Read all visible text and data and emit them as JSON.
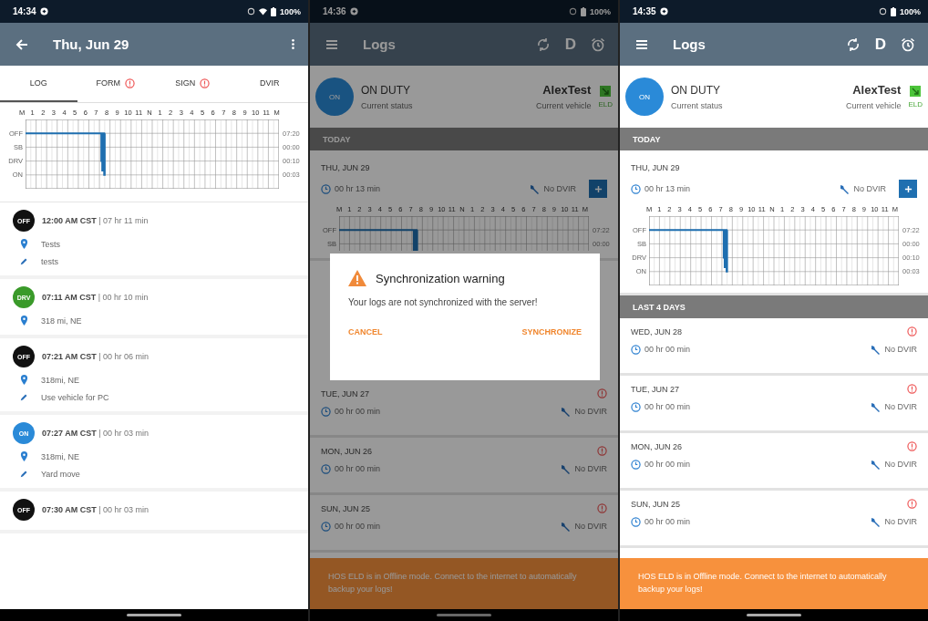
{
  "screens": [
    {
      "kind": "day_log",
      "status_bar": {
        "time": "14:34",
        "wifi": true,
        "battery": "100%"
      },
      "app_bar": {
        "title": "Thu, Jun 29",
        "actions": [
          {
            "kind": "more"
          }
        ]
      },
      "tabs": [
        {
          "label": "LOG",
          "selected": true,
          "alert": false
        },
        {
          "label": "FORM",
          "selected": false,
          "alert": true
        },
        {
          "label": "SIGN",
          "selected": false,
          "alert": true
        },
        {
          "label": "DVIR",
          "selected": false,
          "alert": false
        }
      ],
      "graph": {
        "hours": [
          "M",
          "1",
          "2",
          "3",
          "4",
          "5",
          "6",
          "7",
          "8",
          "9",
          "10",
          "11",
          "N",
          "1",
          "2",
          "3",
          "4",
          "5",
          "6",
          "7",
          "8",
          "9",
          "10",
          "11",
          "M"
        ],
        "rows": [
          "OFF",
          "SB",
          "DRV",
          "ON"
        ],
        "totals": [
          "07:20",
          "00:00",
          "00:10",
          "00:03"
        ]
      },
      "events": [
        {
          "status": "OFF",
          "color": "#111111",
          "heading": "**12:00 AM CST** | 07 hr 11 min",
          "details": [
            {
              "kind": "location",
              "text": "Tests"
            },
            {
              "kind": "note",
              "text": "tests"
            }
          ]
        },
        {
          "status": "DRV",
          "color": "#3a9a2a",
          "heading": "**07:11 AM CST** | 00 hr 10 min",
          "details": [
            {
              "kind": "location",
              "text": "318 mi, NE"
            }
          ]
        },
        {
          "status": "OFF",
          "color": "#111111",
          "heading": "**07:21 AM CST** | 00 hr 06 min",
          "details": [
            {
              "kind": "location",
              "text": "318mi, NE"
            },
            {
              "kind": "note",
              "text": "Use vehicle for PC"
            }
          ]
        },
        {
          "status": "ON",
          "color": "#2a8ad8",
          "heading": "**07:27 AM CST** | 00 hr 03 min",
          "details": [
            {
              "kind": "location",
              "text": "318mi, NE"
            },
            {
              "kind": "note",
              "text": "Yard move"
            }
          ]
        },
        {
          "status": "OFF",
          "color": "#111111",
          "heading": "**07:30 AM CST** | 00 hr 03 min"
        }
      ]
    },
    {
      "kind": "logs",
      "status_bar": {
        "time": "14:36",
        "wifi": false,
        "battery": "100%"
      },
      "app_bar": {
        "title": "Logs",
        "actions": [
          {
            "kind": "sync"
          },
          {
            "kind": "text",
            "text": "D"
          },
          {
            "kind": "alarm"
          }
        ]
      },
      "duty": {
        "status": "ON",
        "label": "ON DUTY",
        "sub": "Current status",
        "vehicle": "AlexTest",
        "vehicle_sub": "Current vehicle",
        "eld": "ELD"
      },
      "today_header": "TODAY",
      "today": {
        "date": "THU, JUN 29",
        "duration": "00 hr 13 min",
        "dvir": "No DVIR"
      },
      "graph": {
        "hours": [
          "M",
          "1",
          "2",
          "3",
          "4",
          "5",
          "6",
          "7",
          "8",
          "9",
          "10",
          "11",
          "N",
          "1",
          "2",
          "3",
          "4",
          "5",
          "6",
          "7",
          "8",
          "9",
          "10",
          "11",
          "M"
        ],
        "rows": [
          "OFF",
          "SB"
        ],
        "totals": [
          "07:22",
          "00:00"
        ]
      },
      "days": [
        {
          "date": "TUE, JUN 27",
          "duration": "00 hr 00 min",
          "dvir": "No DVIR",
          "alert": true
        },
        {
          "date": "MON, JUN 26",
          "duration": "00 hr 00 min",
          "dvir": "No DVIR",
          "alert": true
        },
        {
          "date": "SUN, JUN 25",
          "duration": "00 hr 00 min",
          "dvir": "No DVIR",
          "alert": true
        }
      ],
      "banner": "HOS ELD is in Offline mode. Connect to the internet to automatically backup your logs!",
      "dialog": {
        "title": "Synchronization warning",
        "message": "Your logs are not synchronized with the server!",
        "buttons": [
          "CANCEL",
          "SYNCHRONIZE"
        ]
      }
    },
    {
      "kind": "logs",
      "status_bar": {
        "time": "14:35",
        "wifi": false,
        "battery": "100%"
      },
      "app_bar": {
        "title": "Logs",
        "actions": [
          {
            "kind": "sync"
          },
          {
            "kind": "text",
            "text": "D"
          },
          {
            "kind": "alarm"
          }
        ]
      },
      "duty": {
        "status": "ON",
        "label": "ON DUTY",
        "sub": "Current status",
        "vehicle": "AlexTest",
        "vehicle_sub": "Current vehicle",
        "eld": "ELD"
      },
      "today_header": "TODAY",
      "today": {
        "date": "THU, JUN 29",
        "duration": "00 hr 13 min",
        "dvir": "No DVIR"
      },
      "graph": {
        "hours": [
          "M",
          "1",
          "2",
          "3",
          "4",
          "5",
          "6",
          "7",
          "8",
          "9",
          "10",
          "11",
          "N",
          "1",
          "2",
          "3",
          "4",
          "5",
          "6",
          "7",
          "8",
          "9",
          "10",
          "11",
          "M"
        ],
        "rows": [
          "OFF",
          "SB",
          "DRV",
          "ON"
        ],
        "totals": [
          "07:22",
          "00:00",
          "00:10",
          "00:03"
        ]
      },
      "days_header": "LAST 4 DAYS",
      "days": [
        {
          "date": "WED, JUN 28",
          "duration": "00 hr 00 min",
          "dvir": "No DVIR",
          "alert": true
        },
        {
          "date": "TUE, JUN 27",
          "duration": "00 hr 00 min",
          "dvir": "No DVIR",
          "alert": true
        },
        {
          "date": "MON, JUN 26",
          "duration": "00 hr 00 min",
          "dvir": "No DVIR",
          "alert": true
        },
        {
          "date": "SUN, JUN 25",
          "duration": "00 hr 00 min",
          "dvir": "No DVIR",
          "alert": true
        }
      ],
      "banner": "HOS ELD is in Offline mode. Connect to the internet to automatically backup your logs!"
    }
  ]
}
